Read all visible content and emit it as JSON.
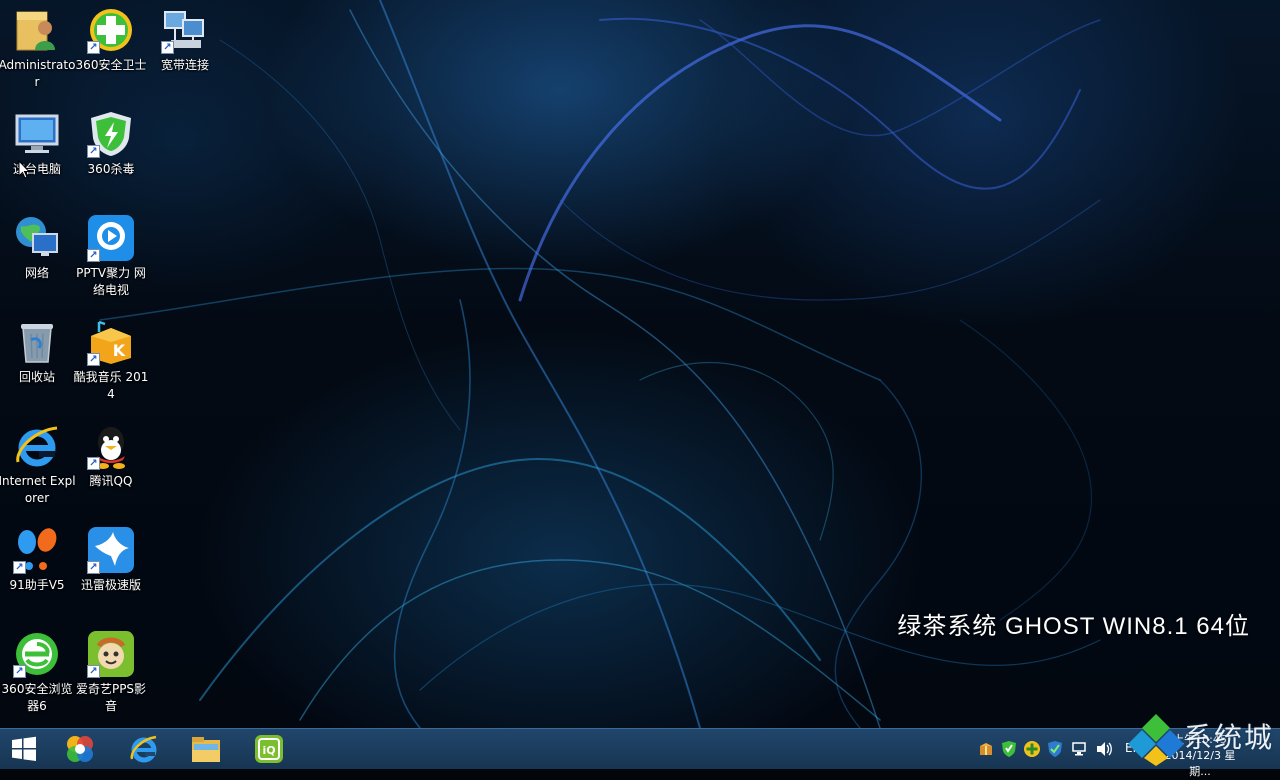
{
  "desktop": {
    "icons": [
      {
        "label": "Administrator",
        "icon": "user-folder-icon",
        "shortcut": false
      },
      {
        "label": "360安全卫士",
        "icon": "360-security-icon",
        "shortcut": true
      },
      {
        "label": "宽带连接",
        "icon": "broadband-connection-icon",
        "shortcut": true
      },
      {
        "label": "这台电脑",
        "icon": "this-pc-icon",
        "shortcut": false
      },
      {
        "label": "360杀毒",
        "icon": "360-antivirus-icon",
        "shortcut": true
      },
      {
        "label": "网络",
        "icon": "network-icon",
        "shortcut": false
      },
      {
        "label": "PPTV聚力 网络电视",
        "icon": "pptv-icon",
        "shortcut": true
      },
      {
        "label": "回收站",
        "icon": "recycle-bin-icon",
        "shortcut": false
      },
      {
        "label": "酷我音乐 2014",
        "icon": "kuwo-music-icon",
        "shortcut": true
      },
      {
        "label": "Internet Explorer",
        "icon": "internet-explorer-icon",
        "shortcut": false
      },
      {
        "label": "腾讯QQ",
        "icon": "qq-icon",
        "shortcut": true
      },
      {
        "label": "91助手V5",
        "icon": "91-assistant-icon",
        "shortcut": true
      },
      {
        "label": "迅雷极速版",
        "icon": "xunlei-icon",
        "shortcut": true
      },
      {
        "label": "360安全浏览器6",
        "icon": "360-browser-icon",
        "shortcut": true
      },
      {
        "label": "爱奇艺PPS影音",
        "icon": "iqiyi-pps-icon",
        "shortcut": true
      }
    ],
    "brand_text": "绿茶系统  GHOST  WIN8.1  64位"
  },
  "taskbar": {
    "pinned": [
      {
        "name": "start-button",
        "icon": "windows-logo-icon"
      },
      {
        "name": "taskbar-360-browser",
        "icon": "360-browser-colorful-icon"
      },
      {
        "name": "taskbar-internet-explorer",
        "icon": "internet-explorer-icon"
      },
      {
        "name": "taskbar-file-explorer",
        "icon": "file-explorer-icon"
      },
      {
        "name": "taskbar-iqiyi",
        "icon": "iqiyi-icon"
      }
    ],
    "tray": {
      "icons": [
        "package-icon",
        "360-shield-icon",
        "360-plus-icon",
        "check-shield-icon",
        "network-icon",
        "speaker-icon"
      ],
      "lang": "EN",
      "time": "上午10:45",
      "date": "2014/12/3 星期..."
    }
  },
  "watermark": {
    "text": "系统城"
  },
  "colors": {
    "taskbar": "#1f4366",
    "accent_green": "#3ebf3a",
    "accent_blue": "#1e7ad6"
  }
}
